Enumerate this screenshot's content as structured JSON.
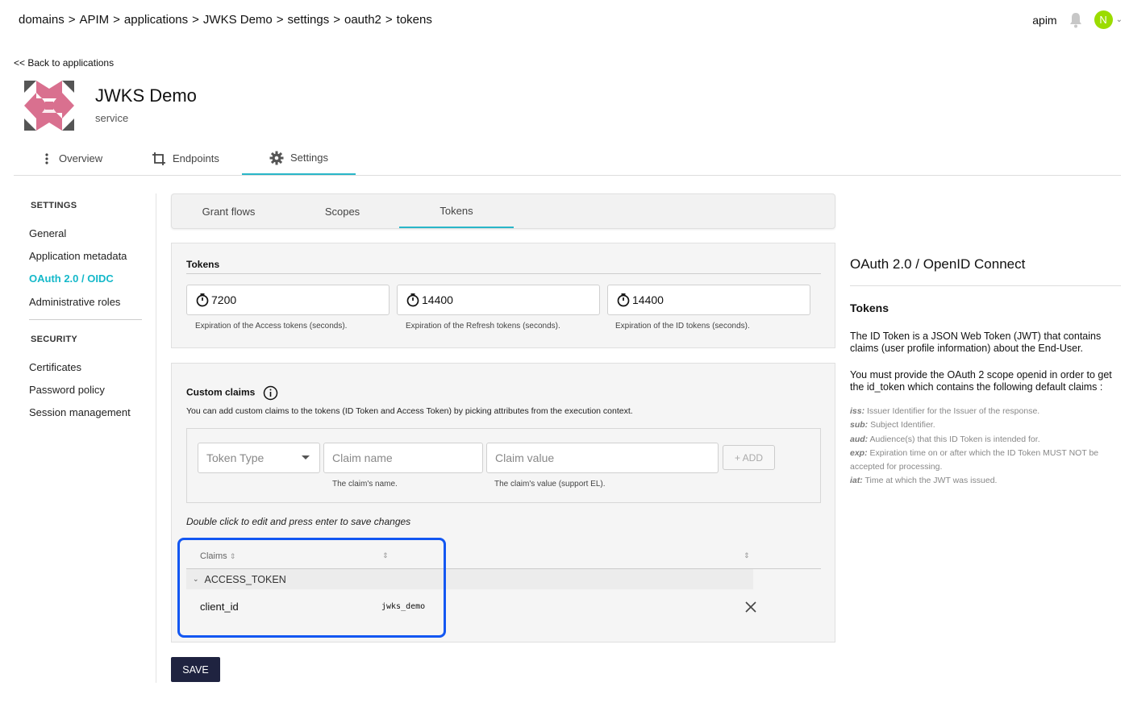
{
  "breadcrumb": {
    "items": [
      "domains",
      ">",
      "APIM",
      ">",
      "applications",
      ">",
      "JWKS Demo",
      ">",
      "settings",
      ">",
      "oauth2",
      ">",
      "tokens"
    ]
  },
  "user": {
    "name": "apim",
    "initial": "N",
    "avatar_color": "#9bdc00"
  },
  "back_link": "<< Back to applications",
  "app": {
    "name": "JWKS Demo",
    "type": "service"
  },
  "main_tabs": [
    {
      "label": "Overview",
      "icon": "more-vert-icon"
    },
    {
      "label": "Endpoints",
      "icon": "crop-icon"
    },
    {
      "label": "Settings",
      "icon": "gear-icon",
      "active": true
    }
  ],
  "leftnav": {
    "settings_header": "SETTINGS",
    "settings_items": [
      "General",
      "Application metadata",
      "OAuth 2.0 / OIDC",
      "Administrative roles"
    ],
    "active_item": "OAuth 2.0 / OIDC",
    "security_header": "SECURITY",
    "security_items": [
      "Certificates",
      "Password policy",
      "Session management"
    ]
  },
  "sub_tabs": [
    "Grant flows",
    "Scopes",
    "Tokens"
  ],
  "active_sub_tab": "Tokens",
  "tokens": {
    "title": "Tokens",
    "access_value": "7200",
    "access_hint": "Expiration of the Access tokens (seconds).",
    "refresh_value": "14400",
    "refresh_hint": "Expiration of the Refresh tokens (seconds).",
    "id_value": "14400",
    "id_hint": "Expiration of the ID tokens (seconds)."
  },
  "custom_claims": {
    "title": "Custom claims",
    "description": "You can add custom claims to the tokens (ID Token and Access Token) by picking attributes from the execution context.",
    "token_type_placeholder": "Token Type",
    "claim_name_placeholder": "Claim name",
    "claim_name_hint": "The claim's name.",
    "claim_value_placeholder": "Claim value",
    "claim_value_hint": "The claim's value (support EL).",
    "add_label": "+ ADD",
    "edit_hint": "Double click to edit and press enter to save changes",
    "table": {
      "column_claims": "Claims",
      "group": "ACCESS_TOKEN",
      "rows": [
        {
          "name": "client_id",
          "value": "jwks_demo"
        }
      ]
    }
  },
  "save_label": "SAVE",
  "help": {
    "title": "OAuth 2.0 / OpenID Connect",
    "subtitle": "Tokens",
    "p1": "The ID Token is a JSON Web Token (JWT) that contains claims (user profile information) about the End-User.",
    "p2": "You must provide the OAuth 2 scope openid in order to get the id_token which contains the following default claims :",
    "claims": [
      {
        "key": "iss:",
        "text": "Issuer Identifier for the Issuer of the response."
      },
      {
        "key": "sub:",
        "text": "Subject Identifier."
      },
      {
        "key": "aud:",
        "text": "Audience(s) that this ID Token is intended for."
      },
      {
        "key": "exp:",
        "text": "Expiration time on or after which the ID Token MUST NOT be accepted for processing."
      },
      {
        "key": "iat:",
        "text": "Time at which the JWT was issued."
      }
    ]
  },
  "colors": {
    "accent": "#29b6c8",
    "active_nav": "#14b8c9",
    "highlight": "#1357f2",
    "save_button": "#1f2340"
  }
}
